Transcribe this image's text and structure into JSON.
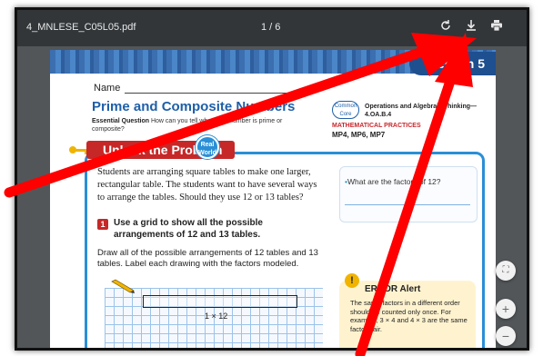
{
  "toolbar": {
    "file_name": "4_MNLESE_C05L05.pdf",
    "page_indicator": "1 / 6",
    "rotate_icon": "rotate-icon",
    "download_icon": "download-icon",
    "print_icon": "print-icon"
  },
  "page": {
    "lesson_tab": "Lesson 5",
    "name_label": "Name",
    "title": "Prime and Composite Numbers",
    "essential_question_label": "Essential Question",
    "essential_question_text": "How can you tell whether a number is prime or composite?",
    "common_core_logo": "Common Core",
    "standard_text": "Operations and Algebraic Thinking—4.OA.B.4",
    "math_practices_label": "MATHEMATICAL PRACTICES",
    "math_practices": "MP4, MP6, MP7",
    "unlock_banner": "Unlock the Problem",
    "real_world_badge": "Real World",
    "intro_text": "Students are arranging square tables to make one larger, rectangular table. The students want to have several ways to arrange the tables. Should they use 12 or 13 tables?",
    "step_number": "1",
    "step_text": "Use a grid to show all the possible arrangements of 12 and 13 tables.",
    "instruction_text": "Draw all of the possible arrangements of 12 tables and 13 tables. Label each drawing with the factors modeled.",
    "rectangle_label": "1 × 12",
    "side_question": "What are the factors of 12?",
    "error_alert_title": "ERROR Alert",
    "error_alert_text": "The same factors in a different order should be counted only once. For example, 3 × 4 and 4 × 3 are the same factor pair."
  },
  "viewer": {
    "fit_icon": "fit-page-icon",
    "zoom_in": "+",
    "zoom_out": "−"
  },
  "colors": {
    "annotation": "#ff0000",
    "toolbar_bg": "#323639",
    "viewer_bg": "#525659",
    "title_blue": "#1e5fa8",
    "banner_red": "#c62828"
  }
}
